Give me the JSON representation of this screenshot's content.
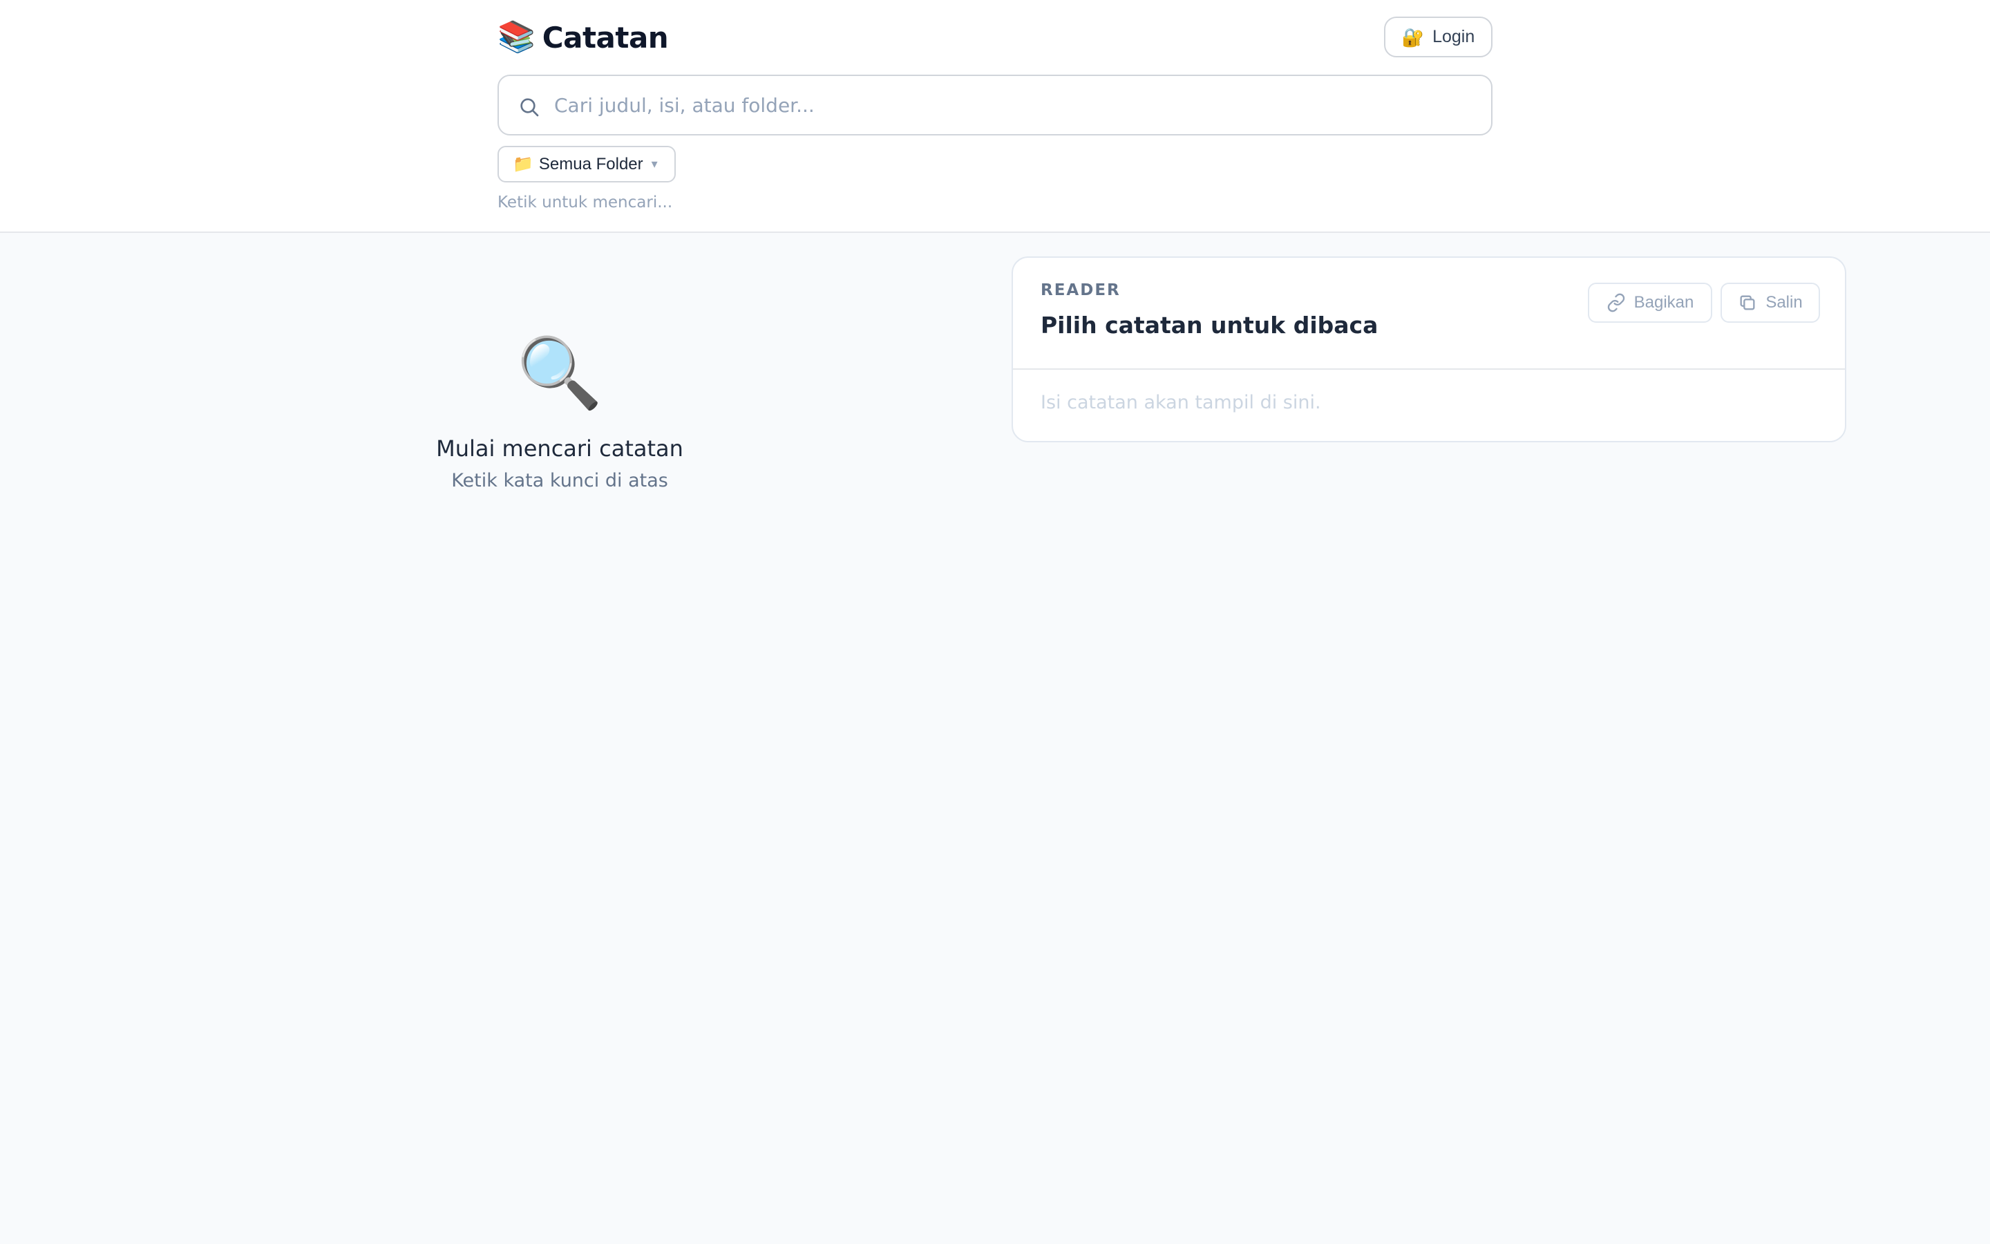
{
  "header": {
    "brand_icon": "📚",
    "brand_title": "Catatan",
    "login": {
      "icon": "🔐",
      "label": "Login"
    },
    "search": {
      "placeholder": "Cari judul, isi, atau folder...",
      "value": ""
    },
    "folder_filter": {
      "icon": "📁",
      "selected": "Semua Folder",
      "chevron": "▾"
    },
    "hint": "Ketik untuk mencari..."
  },
  "empty_state": {
    "icon": "🔍",
    "title": "Mulai mencari catatan",
    "subtitle": "Ketik kata kunci di atas"
  },
  "reader": {
    "label": "READER",
    "title": "Pilih catatan untuk dibaca",
    "share_label": "Bagikan",
    "copy_label": "Salin",
    "body": "Isi catatan akan tampil di sini."
  },
  "colors": {
    "background": "#f8fafc",
    "surface": "#ffffff",
    "border": "#d1d5db",
    "text_primary": "#0f172a",
    "text_muted": "#94a3b8"
  }
}
